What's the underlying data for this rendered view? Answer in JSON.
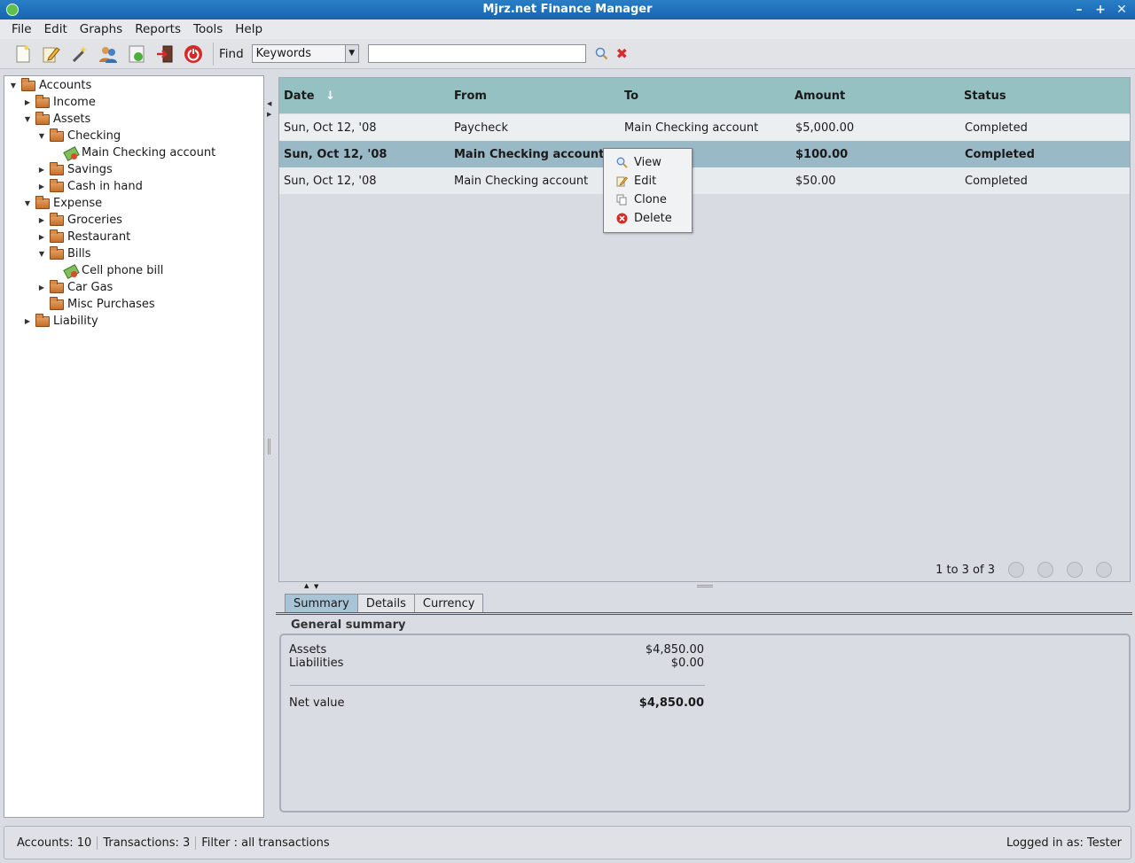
{
  "window": {
    "title": "Mjrz.net Finance Manager",
    "min": "–",
    "max": "+",
    "close": "✕"
  },
  "menu": [
    "File",
    "Edit",
    "Graphs",
    "Reports",
    "Tools",
    "Help"
  ],
  "toolbar": {
    "find_label": "Find",
    "find_combo": "Keywords",
    "search_value": ""
  },
  "tree": [
    {
      "label": "Accounts",
      "toggle": "▼",
      "icon": "folder"
    },
    {
      "label": "Income",
      "toggle": "▶",
      "icon": "folder"
    },
    {
      "label": "Assets",
      "toggle": "▼",
      "icon": "folder"
    },
    {
      "label": "Checking",
      "toggle": "▼",
      "icon": "folder"
    },
    {
      "label": "Main Checking account",
      "toggle": "",
      "icon": "money"
    },
    {
      "label": "Savings",
      "toggle": "▶",
      "icon": "folder"
    },
    {
      "label": "Cash in hand",
      "toggle": "▶",
      "icon": "folder"
    },
    {
      "label": "Expense",
      "toggle": "▼",
      "icon": "folder"
    },
    {
      "label": "Groceries",
      "toggle": "▶",
      "icon": "folder"
    },
    {
      "label": "Restaurant",
      "toggle": "▶",
      "icon": "folder"
    },
    {
      "label": "Bills",
      "toggle": "▼",
      "icon": "folder"
    },
    {
      "label": "Cell phone bill",
      "toggle": "",
      "icon": "money"
    },
    {
      "label": "Car Gas",
      "toggle": "▶",
      "icon": "folder"
    },
    {
      "label": "Misc Purchases",
      "toggle": "",
      "icon": "folder"
    },
    {
      "label": "Liability",
      "toggle": "▶",
      "icon": "folder"
    }
  ],
  "table": {
    "columns": [
      "Date",
      "From",
      "To",
      "Amount",
      "Status"
    ],
    "sort_indicator": "↓",
    "rows": [
      {
        "date": "Sun, Oct 12, '08",
        "from": "Paycheck",
        "to": "Main Checking account",
        "amount": "$5,000.00",
        "status": "Completed"
      },
      {
        "date": "Sun, Oct 12, '08",
        "from": "Main Checking account",
        "to": "",
        "amount": "$100.00",
        "status": "Completed"
      },
      {
        "date": "Sun, Oct 12, '08",
        "from": "Main Checking account",
        "to": "",
        "amount": "$50.00",
        "status": "Completed"
      }
    ],
    "pager": "1 to 3 of 3"
  },
  "context_menu": [
    "View",
    "Edit",
    "Clone",
    "Delete"
  ],
  "tabs": [
    "Summary",
    "Details",
    "Currency"
  ],
  "summary": {
    "title": "General summary",
    "assets_label": "Assets",
    "assets_value": "$4,850.00",
    "liabilities_label": "Liabilities",
    "liabilities_value": "$0.00",
    "net_label": "Net value",
    "net_value": "$4,850.00"
  },
  "status": {
    "accounts": "Accounts: 10",
    "transactions": "Transactions: 3",
    "filter": "Filter : all transactions",
    "user": "Logged in as: Tester"
  }
}
